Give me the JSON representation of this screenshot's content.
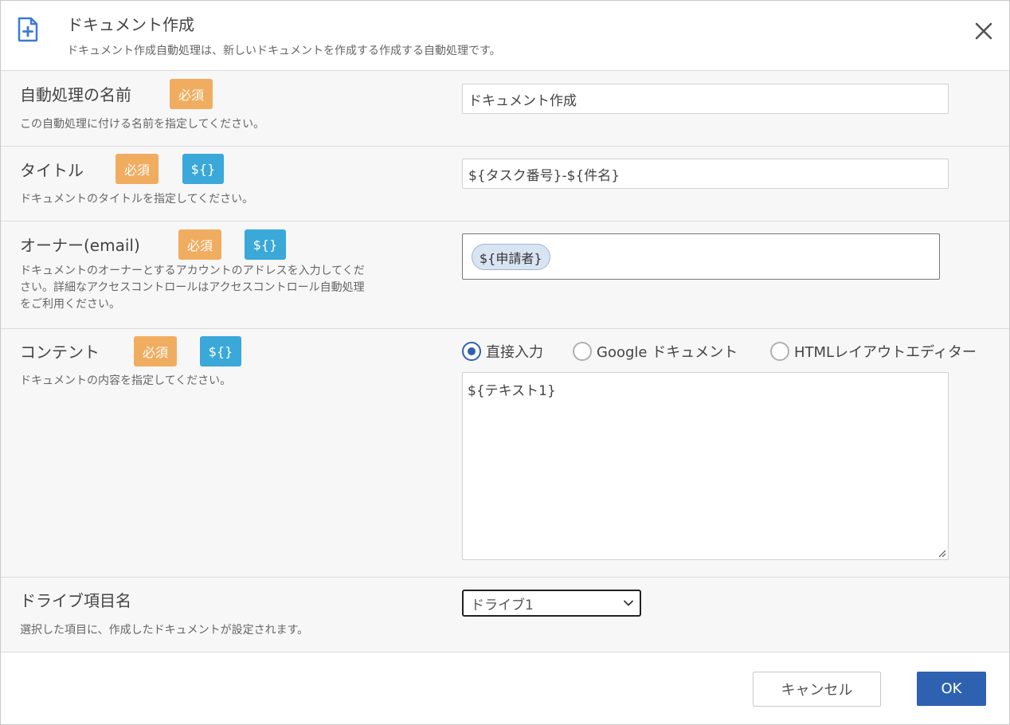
{
  "dialog": {
    "title": "ドキュメント作成",
    "description": "ドキュメント作成自動処理は、新しいドキュメントを作成する作成する自動処理です。",
    "icon": "document-plus-icon"
  },
  "badges": {
    "required": "必須",
    "variable": "${}"
  },
  "fields": {
    "name": {
      "label": "自動処理の名前",
      "description": "この自動処理に付ける名前を指定してください。",
      "value": "ドキュメント作成"
    },
    "title": {
      "label": "タイトル",
      "description": "ドキュメントのタイトルを指定してください。",
      "value": "${タスク番号}-${件名}"
    },
    "owner": {
      "label": "オーナー(email)",
      "description_lines": [
        "ドキュメントのオーナーとするアカウントのアドレスを入力してくだ",
        "さい。詳細なアクセスコントロールはアクセスコントロール自動処理",
        "をご利用ください。"
      ],
      "chip": "${申請者}"
    },
    "content": {
      "label": "コンテント",
      "description": "ドキュメントの内容を指定してください。",
      "options": [
        "直接入力",
        "Google ドキュメント",
        "HTMLレイアウトエディター"
      ],
      "selected": "直接入力",
      "value": "${テキスト1}"
    },
    "drive": {
      "label": "ドライブ項目名",
      "description": "選択した項目に、作成したドキュメントが設定されます。",
      "selected": "ドライブ1"
    }
  },
  "footer": {
    "cancel_label": "キャンセル",
    "ok_label": "OK"
  },
  "colors": {
    "accent": "#2e61b0",
    "required_badge": "#f0ad60",
    "variable_badge": "#3aa8d8",
    "chip_bg": "#d9e4f2"
  }
}
